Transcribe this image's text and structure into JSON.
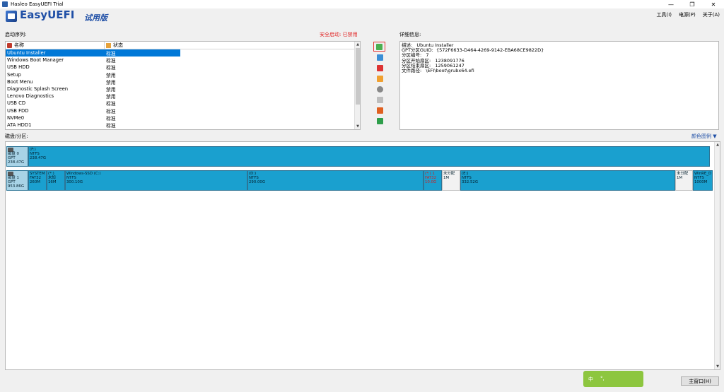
{
  "window": {
    "title": "Hasleo EasyUEFI Trial"
  },
  "brand": {
    "name": "EasyUEFI",
    "edition": "试用版"
  },
  "menu": [
    "工具(I)",
    "电源(P)",
    "关于(A)"
  ],
  "boot": {
    "label": "启动序列:",
    "secure_boot": "安全启动: 已禁用",
    "col_name": "名称",
    "col_status": "状态",
    "entries": [
      {
        "name": "Ubuntu Installer",
        "status": "标准"
      },
      {
        "name": "Windows Boot Manager",
        "status": "标准"
      },
      {
        "name": "USB HDD",
        "status": "标准"
      },
      {
        "name": "Setup",
        "status": "禁用"
      },
      {
        "name": "Boot Menu",
        "status": "禁用"
      },
      {
        "name": "Diagnostic Splash Screen",
        "status": "禁用"
      },
      {
        "name": "Lenovo Diagnostics",
        "status": "禁用"
      },
      {
        "name": "USB CD",
        "status": "标准"
      },
      {
        "name": "USB FDD",
        "status": "标准"
      },
      {
        "name": "NVMe0",
        "status": "标准"
      },
      {
        "name": "ATA HDD1",
        "status": "标准"
      }
    ]
  },
  "detail": {
    "label": "详细信息:",
    "lines": [
      "描述:   Ubuntu Installer",
      "GPT分区GUID:  {572F6633-D464-4269-9142-EBA68CE9822D}",
      "分区编号:   7",
      "分区开始扇区:   1238091776",
      "分区结束扇区:   1259061247",
      "文件路径:   \\EFI\\boot\\grubx64.efi"
    ]
  },
  "disks": {
    "label": "磁盘/分区:",
    "legend": "颜色图例",
    "disk0": {
      "header": [
        "磁盘 0",
        "GPT",
        "238.47G"
      ],
      "parts": [
        {
          "lines": [
            "(F:)",
            "NTFS",
            "238.47G"
          ]
        }
      ]
    },
    "disk1": {
      "header": [
        "磁盘 1",
        "GPT",
        "953.86G"
      ],
      "parts": [
        {
          "lines": [
            "SYSTEM",
            "FAT32",
            "260M"
          ]
        },
        {
          "lines": [
            "(*:)",
            "未知",
            "16M"
          ]
        },
        {
          "lines": [
            "Windows-SSD (C:)",
            "NTFS",
            "300.10G"
          ]
        },
        {
          "lines": [
            "(D:)",
            "NTFS",
            "290.00G"
          ]
        },
        {
          "lines": [
            "(*:) 1",
            "FAT32",
            "10.0G"
          ]
        },
        {
          "lines": [
            "未分配",
            "1M"
          ]
        },
        {
          "lines": [
            "(E:)",
            "NTFS",
            "332.52G"
          ]
        },
        {
          "lines": [
            "未分配",
            "1M"
          ]
        },
        {
          "lines": [
            "WinRE_D",
            "NTFS",
            "1000M"
          ]
        }
      ]
    }
  },
  "ime": {
    "mode": "中",
    "punct": "°,"
  },
  "main_window_button": "主窗口(H)"
}
